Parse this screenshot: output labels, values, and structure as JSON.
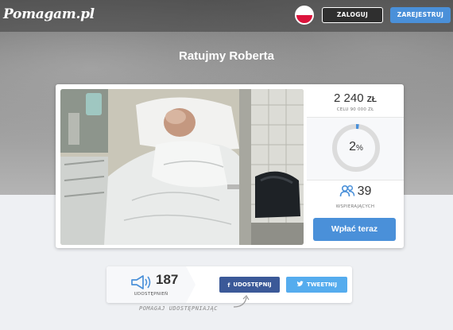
{
  "header": {
    "logo": "Pomagam.pl",
    "language_flag": "poland-flag-icon",
    "login_label": "ZALOGUJ",
    "register_label": "ZAREJESTRUJ"
  },
  "campaign": {
    "title": "Ratujmy Roberta",
    "photo_icon": "campaign-photo",
    "amount_value": "2 240",
    "amount_unit": "ZŁ",
    "goal_label": "CELU 90 000 ZŁ",
    "progress_percent": 2,
    "progress_value": "2",
    "progress_symbol": "%",
    "supporters_count": "39",
    "supporters_icon": "people-icon",
    "supporters_label": "WSPIERAJĄCYCH",
    "pay_button_label": "Wpłać teraz"
  },
  "share": {
    "count": "187",
    "count_icon": "megaphone-icon",
    "count_label": "UDOSTĘPNIEŃ",
    "facebook_label": "UDOSTĘPNIJ",
    "twitter_label": "TWEETNIJ",
    "hint": "POMAGAJ UDOSTĘPNIAJĄC"
  },
  "colors": {
    "accent_blue": "#4a90d9",
    "facebook_blue": "#3b5998",
    "twitter_blue": "#55acee",
    "progress_track": "#dcdcdc",
    "progress_fill": "#4a90d9"
  }
}
